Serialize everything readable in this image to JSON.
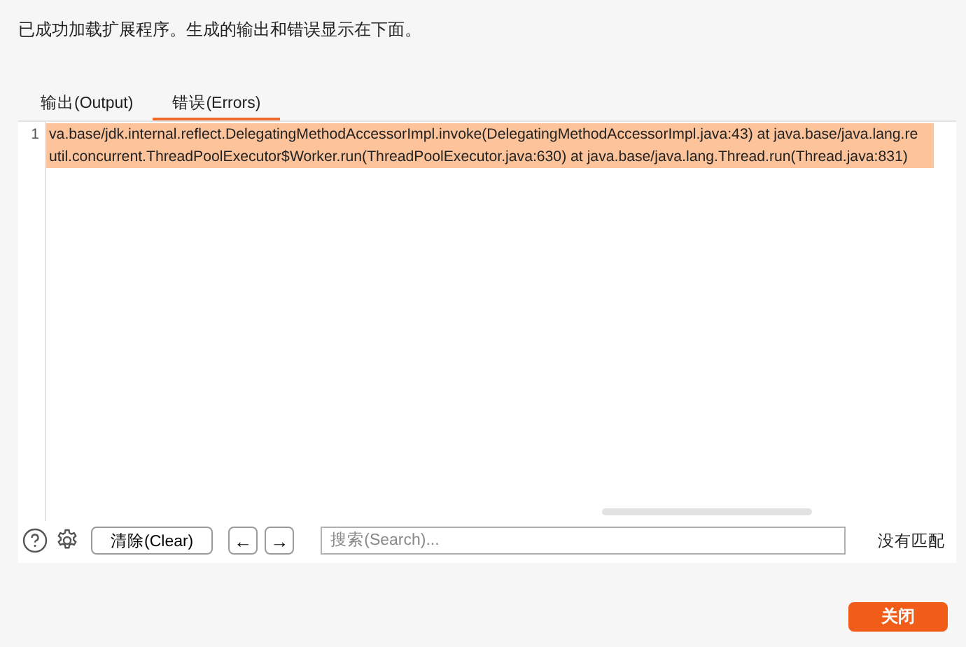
{
  "message": "已成功加载扩展程序。生成的输出和错误显示在下面。",
  "tabs": [
    {
      "label": "输出(Output)",
      "selected": false
    },
    {
      "label": "错误(Errors)",
      "selected": true
    }
  ],
  "editor": {
    "line_number": "1",
    "lines": [
      "va.base/jdk.internal.reflect.DelegatingMethodAccessorImpl.invoke(DelegatingMethodAccessorImpl.java:43) at java.base/java.lang.re",
      "util.concurrent.ThreadPoolExecutor$Worker.run(ThreadPoolExecutor.java:630) at java.base/java.lang.Thread.run(Thread.java:831)"
    ],
    "selected": true
  },
  "toolbar": {
    "clear_button": "清除(Clear)",
    "back_button": "←",
    "forward_button": "→",
    "search": {
      "placeholder": "搜索(Search)..."
    },
    "match_status": "没有匹配"
  },
  "close_button": "关闭"
}
